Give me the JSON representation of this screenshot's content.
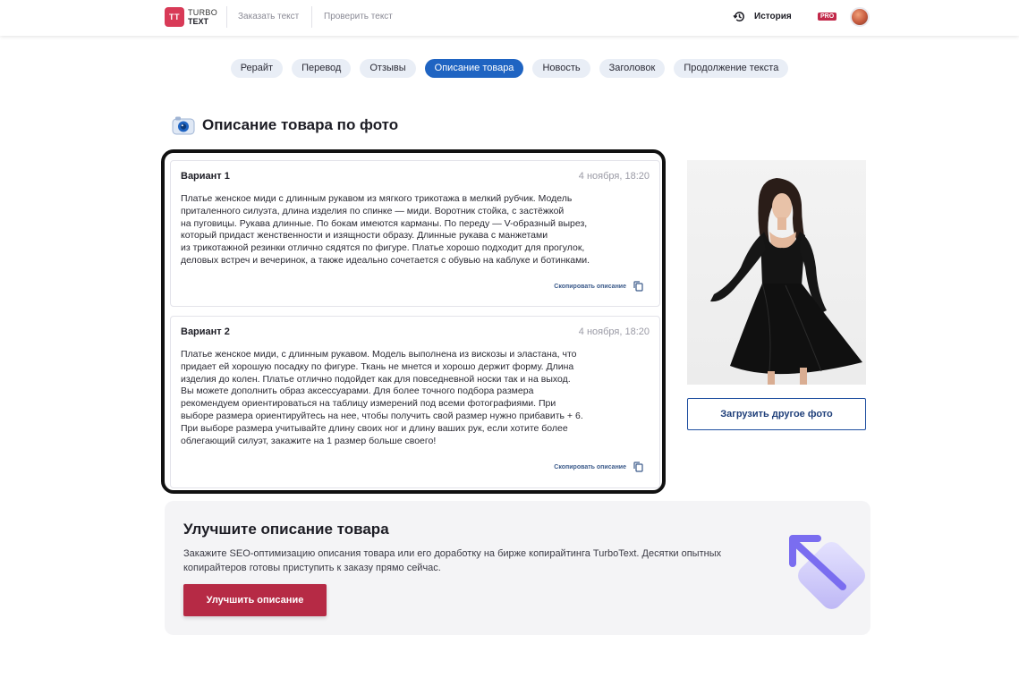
{
  "header": {
    "logo_badge": "TT",
    "logo_line1": "TURBO",
    "logo_line2": "TEXT",
    "nav": [
      "Заказать текст",
      "Проверить текст"
    ],
    "history_label": "История",
    "pro_badge": "PRO"
  },
  "tabs": [
    {
      "label": "Рерайт",
      "active": false
    },
    {
      "label": "Перевод",
      "active": false
    },
    {
      "label": "Отзывы",
      "active": false
    },
    {
      "label": "Описание товара",
      "active": true
    },
    {
      "label": "Новость",
      "active": false
    },
    {
      "label": "Заголовок",
      "active": false
    },
    {
      "label": "Продолжение текста",
      "active": false
    }
  ],
  "page_title": "Описание товара по фото",
  "variants": [
    {
      "title": "Вариант 1",
      "date": "4 ноября, 18:20",
      "lines": [
        "Платье женское миди с длинным рукавом из мягкого трикотажа в мелкий рубчик. Модель",
        "приталенного силуэта, длина изделия по спинке — миди. Воротник стойка, с застёжкой",
        "на пуговицы. Рукава длинные. По бокам имеются карманы. По переду — V-образный вырез,",
        "который придаст женственности и изящности образу. Длинные рукава с манжетами",
        "из трикотажной резинки отлично сядятся по фигуре. Платье хорошо подходит для прогулок,",
        "деловых встреч и вечеринок, а также идеально сочетается с обувью на каблуке и ботинками."
      ],
      "copy_label": "Скопировать описание"
    },
    {
      "title": "Вариант 2",
      "date": "4 ноября, 18:20",
      "lines": [
        "Платье женское миди, с длинным рукавом. Модель выполнена из вискозы и эластана, что",
        "придает ей хорошую посадку по фигуре. Ткань не мнется и хорошо держит форму. Длина",
        "изделия до колен. Платье отлично подойдет как для повседневной носки так и на выход.",
        "Вы можете дополнить образ аксессуарами. Для более точного подбора размера",
        "рекомендуем ориентироваться на таблицу измерений под всеми фотографиями. При",
        "выборе размера ориентируйтесь на нее, чтобы получить свой размер нужно прибавить + 6.",
        "При выборе размера учитывайте длину своих ног и длину ваших рук, если хотите более",
        "облегающий силуэт, закажите на 1 размер больше своего!"
      ],
      "copy_label": "Скопировать описание"
    }
  ],
  "upload_button": "Загрузить другое фото",
  "promo": {
    "title": "Улучшите описание товара",
    "text": "Закажите SEO-оптимизацию описания товара или его доработку на бирже копирайтинга TurboText. Десятки опытных копирайтеров готовы приступить к заказу прямо сейчас.",
    "button": "Улучшить описание"
  },
  "colors": {
    "brand_red": "#d83a57",
    "active_tab": "#1f64c2",
    "button_red": "#b62a45"
  }
}
